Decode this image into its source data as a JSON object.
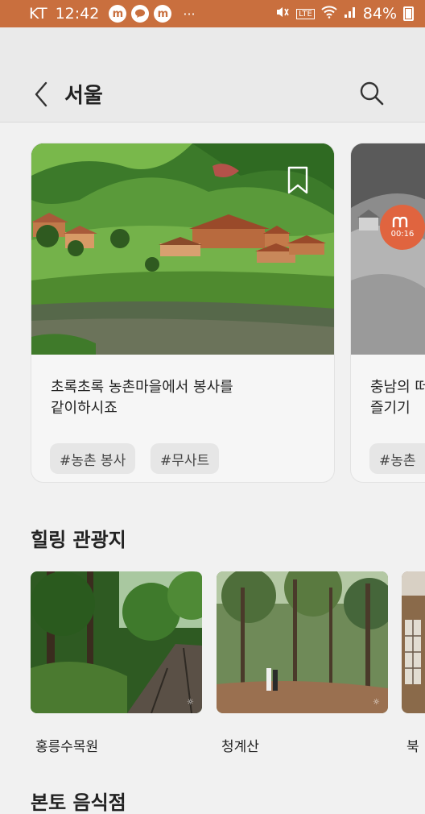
{
  "status_bar": {
    "carrier": "KT",
    "time": "12:42",
    "battery": "84%",
    "app_icons": [
      "m",
      "talk",
      "m"
    ],
    "more": "···",
    "network": "LTE"
  },
  "header": {
    "title": "서울",
    "back_icon": "chevron-left-icon",
    "search_icon": "search-icon"
  },
  "featured": [
    {
      "title_line1": "초록초록 농촌마을에서 봉사를",
      "title_line2": "같이하시죠",
      "tags": [
        "#농촌 봉사",
        "#무사트"
      ],
      "bookmark_icon": "bookmark-icon"
    },
    {
      "title_line1": "충남의 떠",
      "title_line2": "즐기기",
      "tags": [
        "#농촌"
      ],
      "video_time": "00:16"
    }
  ],
  "sections": [
    {
      "title": "힐링 관광지",
      "places": [
        {
          "name": "홍릉수목원"
        },
        {
          "name": "청계산"
        },
        {
          "name": "북"
        }
      ]
    },
    {
      "title": "본토 음식점"
    }
  ],
  "colors": {
    "status_bar": "#c96f3e",
    "background": "#f1f1f1",
    "accent_video": "#e0643f"
  }
}
